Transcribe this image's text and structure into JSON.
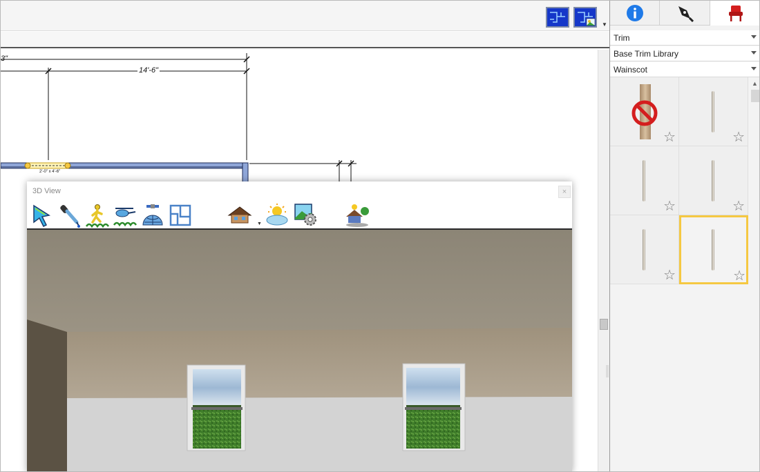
{
  "plan": {
    "dim_top_partial": "3\"",
    "dim_main": "14'-6\"",
    "dim_window": "2'-0\" x 4'-6\""
  },
  "win3d": {
    "title": "3D View",
    "close": "×",
    "tools": [
      {
        "icon": "select-arrow-icon"
      },
      {
        "icon": "eyedropper-icon"
      },
      {
        "icon": "walkthrough-person-icon"
      },
      {
        "icon": "helicopter-icon"
      },
      {
        "icon": "satellite-globe-icon"
      },
      {
        "icon": "floor-plan-view-icon"
      },
      {
        "icon": "house-camera-icon"
      },
      {
        "icon": "sun-clouds-icon"
      },
      {
        "icon": "scene-settings-icon"
      },
      {
        "icon": "house-landscape-icon"
      }
    ]
  },
  "panel": {
    "tabs": [
      {
        "icon": "info-icon",
        "active": false
      },
      {
        "icon": "pen-nib-icon",
        "active": false
      },
      {
        "icon": "chair-icon",
        "active": true
      }
    ],
    "dropdowns": [
      "Trim",
      "Base Trim Library",
      "Wainscot"
    ],
    "library": [
      {
        "type": "none",
        "starred": false
      },
      {
        "type": "trim",
        "starred": false
      },
      {
        "type": "trim",
        "starred": false
      },
      {
        "type": "trim",
        "starred": false
      },
      {
        "type": "trim",
        "starred": false
      },
      {
        "type": "trim",
        "starred": false,
        "selected": true
      }
    ],
    "star_glyph": "☆"
  },
  "colors": {
    "view_button": "#1a3fd6",
    "selection": "#f5c842",
    "wall_fill": "#8fa6d8"
  }
}
